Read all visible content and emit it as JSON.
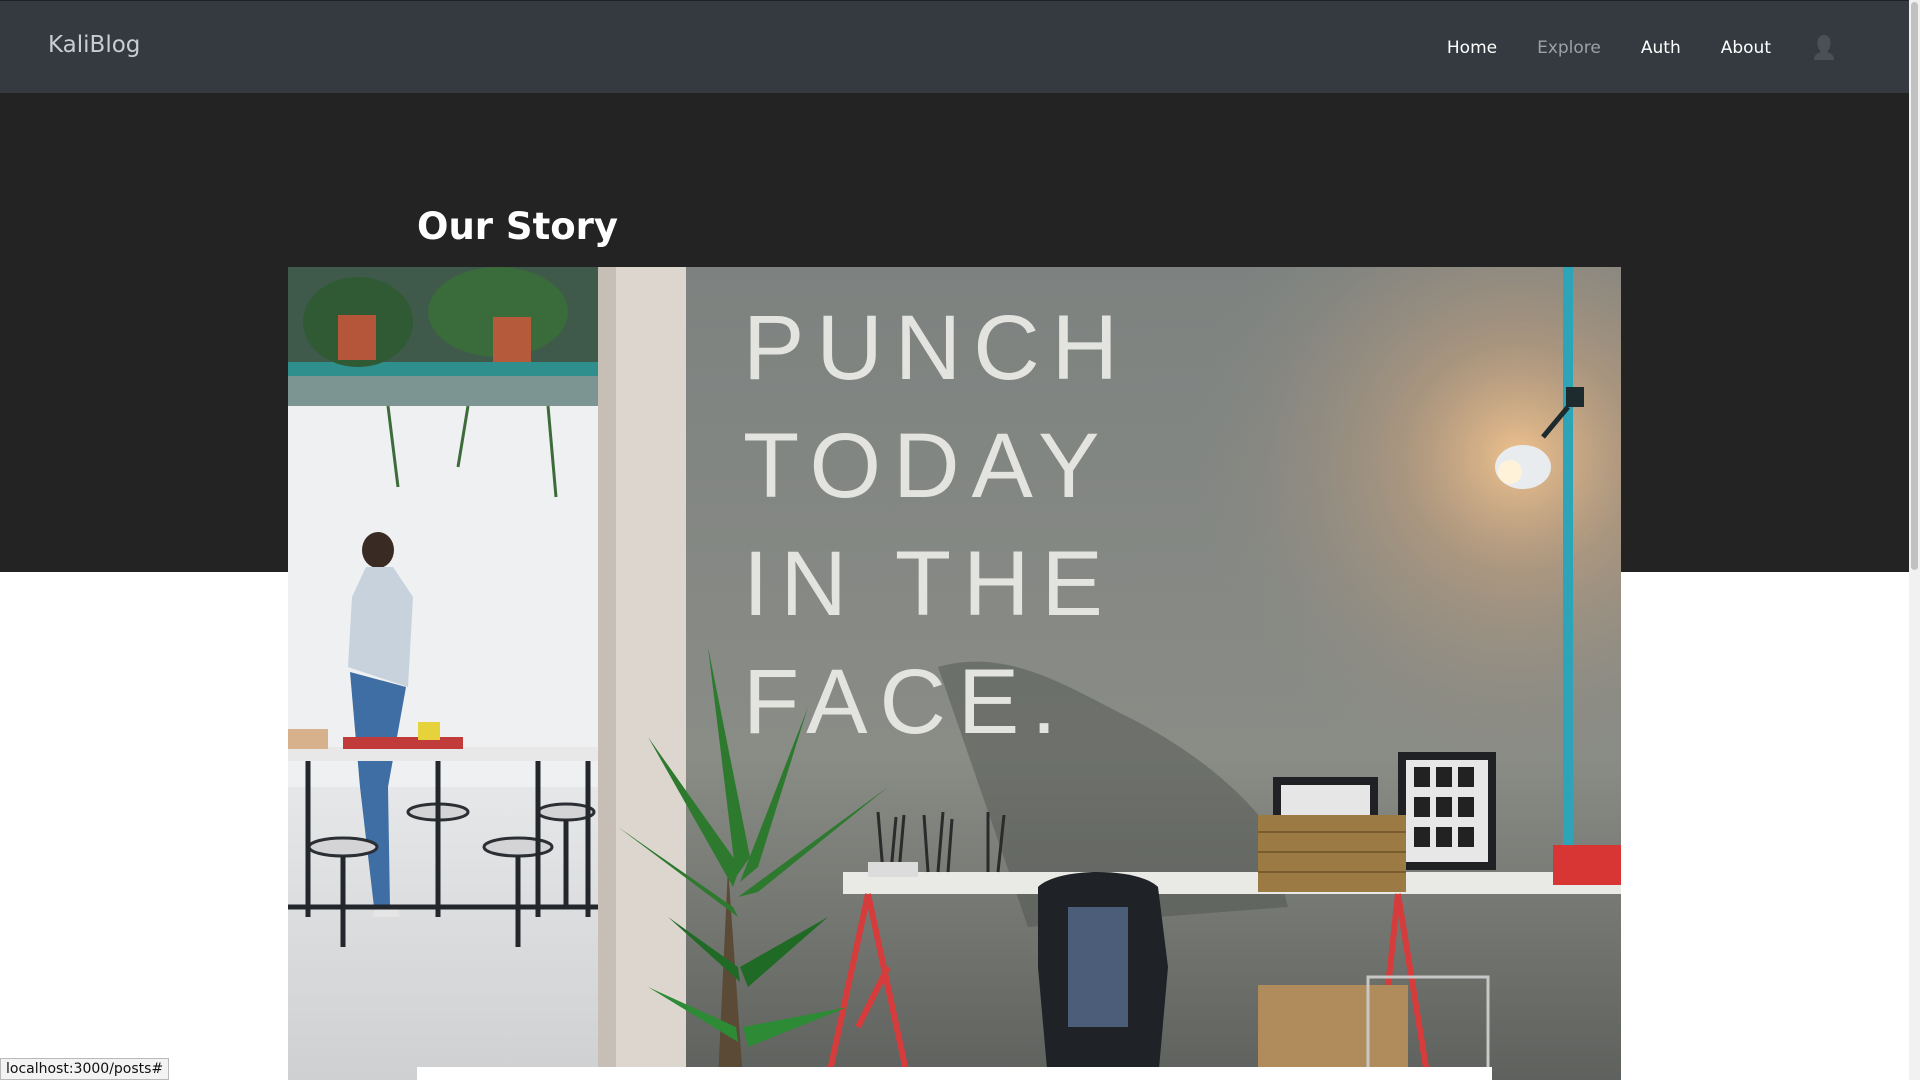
{
  "navbar": {
    "brand": "KaliBlog",
    "links": [
      {
        "label": "Home",
        "active": false
      },
      {
        "label": "Explore",
        "active": true
      },
      {
        "label": "Auth",
        "active": false
      },
      {
        "label": "About",
        "active": false
      }
    ],
    "avatar_icon": "user-icon"
  },
  "page": {
    "title": "Our Story"
  },
  "photo": {
    "wall_text": [
      "PUNCH",
      "TODAY",
      "IN THE",
      "FACE."
    ]
  },
  "status_bar": {
    "url": "localhost:3000/posts#"
  },
  "colors": {
    "navbar_bg": "#343a40",
    "hero_bg": "#232323",
    "active_link": "#9aa1a8"
  }
}
